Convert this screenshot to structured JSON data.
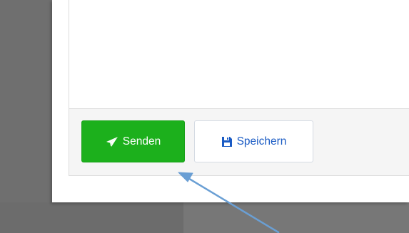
{
  "toolbar": {
    "send_label": "Senden",
    "save_label": "Speichern"
  },
  "icons": {
    "send": "paper-plane-icon",
    "save": "floppy-disk-icon",
    "annotation": "arrow-annotation"
  },
  "colors": {
    "send_button": "#1cb01c",
    "save_text": "#1a5bc4",
    "annotation_arrow": "#6a9fd4",
    "backdrop": "#6f6f6f"
  }
}
